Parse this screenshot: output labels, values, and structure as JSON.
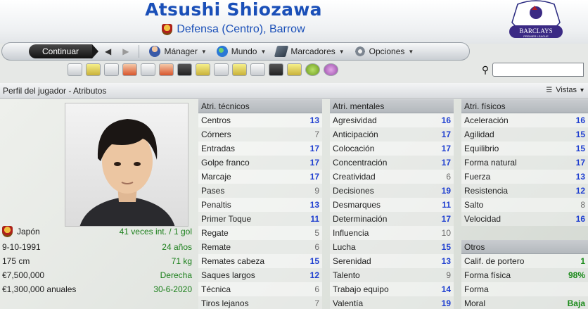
{
  "header": {
    "player_name": "Atsushi Shiozawa",
    "position_club": "Defensa (Centro), Barrow",
    "league_logo_text": "BARCLAYS",
    "league_logo_sub": "PREMIER LEAGUE"
  },
  "nav": {
    "continue_label": "Continuar",
    "manager_label": "Mánager",
    "world_label": "Mundo",
    "bookmarks_label": "Marcadores",
    "options_label": "Opciones"
  },
  "search": {
    "placeholder": ""
  },
  "breadcrumb": "Perfil del jugador - Atributos",
  "views_label": "Vistas",
  "profile": {
    "rows": [
      {
        "left": "Japón",
        "right": "41 veces int. / 1 gol"
      },
      {
        "left": "9-10-1991",
        "right": "24 años"
      },
      {
        "left": "175 cm",
        "right": "71 kg"
      },
      {
        "left": "€7,500,000",
        "right": "Derecha"
      },
      {
        "left": "€1,300,000 anuales",
        "right": "30-6-2020"
      }
    ]
  },
  "technical": {
    "title": "Atri. técnicos",
    "rows": [
      {
        "name": "Centros",
        "value": "13",
        "color": "blue"
      },
      {
        "name": "Córners",
        "value": "7",
        "color": "grey"
      },
      {
        "name": "Entradas",
        "value": "17",
        "color": "blue"
      },
      {
        "name": "Golpe franco",
        "value": "17",
        "color": "blue"
      },
      {
        "name": "Marcaje",
        "value": "17",
        "color": "blue"
      },
      {
        "name": "Pases",
        "value": "9",
        "color": "grey"
      },
      {
        "name": "Penaltis",
        "value": "13",
        "color": "blue"
      },
      {
        "name": "Primer Toque",
        "value": "11",
        "color": "blue"
      },
      {
        "name": "Regate",
        "value": "5",
        "color": "grey"
      },
      {
        "name": "Remate",
        "value": "6",
        "color": "grey"
      },
      {
        "name": "Remates cabeza",
        "value": "15",
        "color": "blue"
      },
      {
        "name": "Saques largos",
        "value": "12",
        "color": "blue"
      },
      {
        "name": "Técnica",
        "value": "6",
        "color": "grey"
      },
      {
        "name": "Tiros lejanos",
        "value": "7",
        "color": "grey"
      }
    ]
  },
  "mental": {
    "title": "Atri. mentales",
    "rows": [
      {
        "name": "Agresividad",
        "value": "16",
        "color": "blue"
      },
      {
        "name": "Anticipación",
        "value": "17",
        "color": "blue"
      },
      {
        "name": "Colocación",
        "value": "17",
        "color": "blue"
      },
      {
        "name": "Concentración",
        "value": "17",
        "color": "blue"
      },
      {
        "name": "Creatividad",
        "value": "6",
        "color": "grey"
      },
      {
        "name": "Decisiones",
        "value": "19",
        "color": "blue"
      },
      {
        "name": "Desmarques",
        "value": "11",
        "color": "blue"
      },
      {
        "name": "Determinación",
        "value": "17",
        "color": "blue"
      },
      {
        "name": "Influencia",
        "value": "10",
        "color": "grey"
      },
      {
        "name": "Lucha",
        "value": "15",
        "color": "blue"
      },
      {
        "name": "Serenidad",
        "value": "13",
        "color": "blue"
      },
      {
        "name": "Talento",
        "value": "9",
        "color": "grey"
      },
      {
        "name": "Trabajo equipo",
        "value": "14",
        "color": "blue"
      },
      {
        "name": "Valentía",
        "value": "19",
        "color": "blue"
      }
    ]
  },
  "physical": {
    "title": "Atri. físicos",
    "rows": [
      {
        "name": "Aceleración",
        "value": "16",
        "color": "blue"
      },
      {
        "name": "Agilidad",
        "value": "15",
        "color": "blue"
      },
      {
        "name": "Equilibrio",
        "value": "15",
        "color": "blue"
      },
      {
        "name": "Forma natural",
        "value": "17",
        "color": "blue"
      },
      {
        "name": "Fuerza",
        "value": "13",
        "color": "blue"
      },
      {
        "name": "Resistencia",
        "value": "12",
        "color": "blue"
      },
      {
        "name": "Salto",
        "value": "8",
        "color": "grey"
      },
      {
        "name": "Velocidad",
        "value": "16",
        "color": "blue"
      }
    ]
  },
  "others": {
    "title": "Otros",
    "rows": [
      {
        "name": "Calif. de portero",
        "value": "1",
        "color": "green"
      },
      {
        "name": "Forma física",
        "value": "98%",
        "color": "green"
      },
      {
        "name": "Forma",
        "value": "",
        "color": "green"
      },
      {
        "name": "Moral",
        "value": "Baja",
        "color": "green"
      }
    ]
  },
  "colors": {
    "title_blue": "#1a4fb8",
    "value_blue": "#1f3fd0",
    "value_green": "#1a8a1a"
  }
}
